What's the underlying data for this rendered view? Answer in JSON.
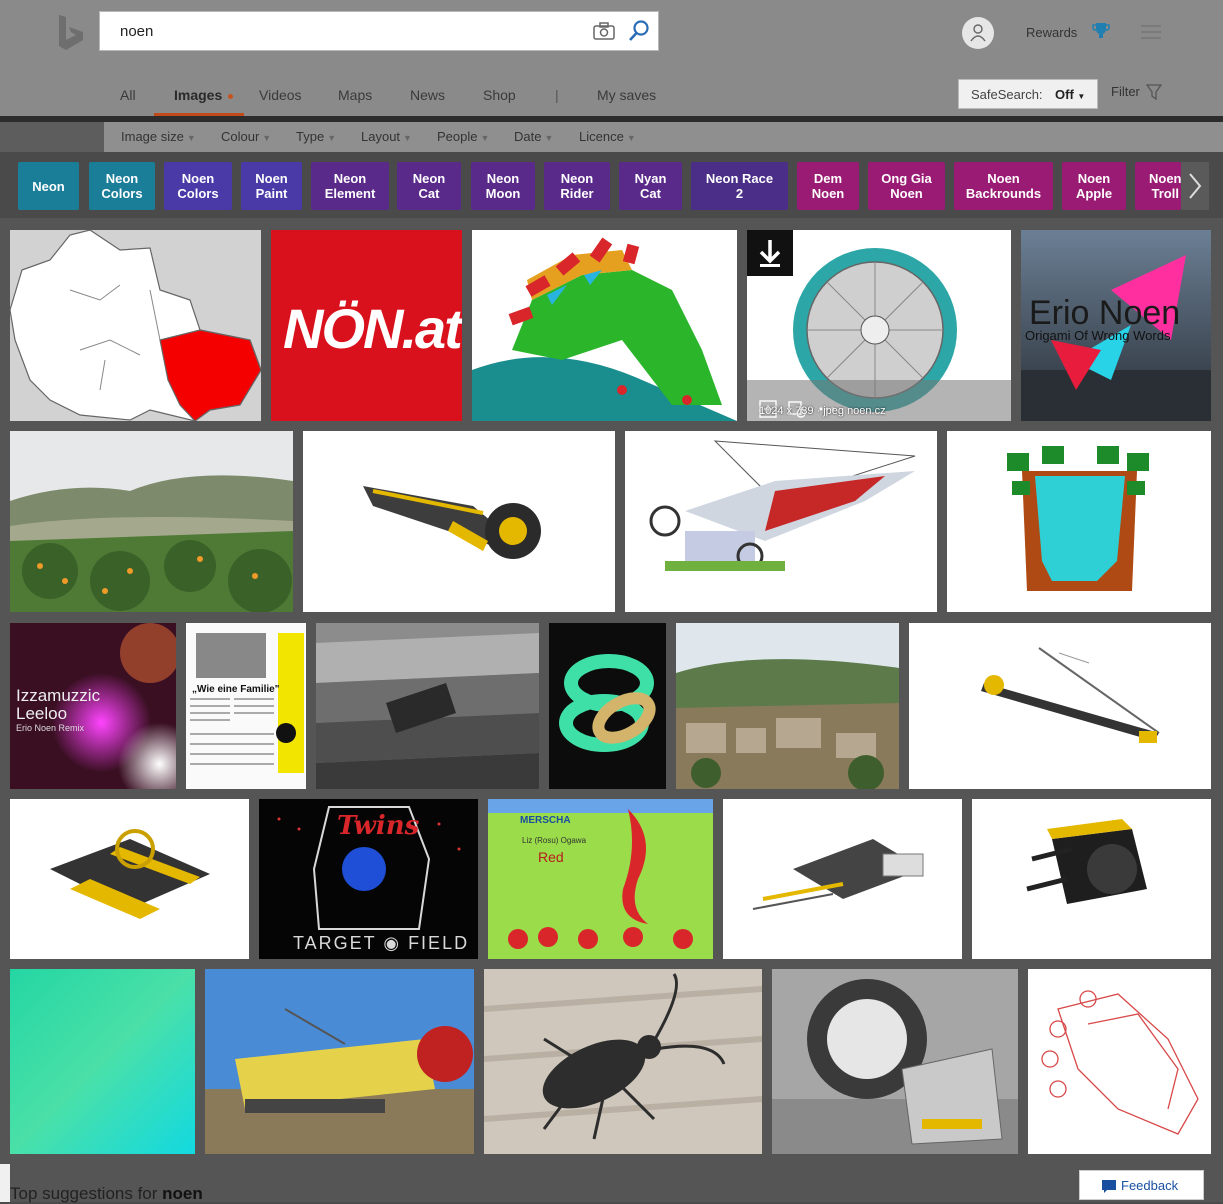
{
  "search": {
    "query": "noen"
  },
  "header": {
    "rewards_label": "Rewards",
    "tabs": [
      {
        "label": "All"
      },
      {
        "label": "Images"
      },
      {
        "label": "Videos"
      },
      {
        "label": "Maps"
      },
      {
        "label": "News"
      },
      {
        "label": "Shop"
      },
      {
        "label": "My saves"
      }
    ],
    "separator": "|",
    "safesearch_label": "SafeSearch:",
    "safesearch_value": "Off",
    "filter_label": "Filter"
  },
  "filters": [
    {
      "label": "Image size"
    },
    {
      "label": "Colour"
    },
    {
      "label": "Type"
    },
    {
      "label": "Layout"
    },
    {
      "label": "People"
    },
    {
      "label": "Date"
    },
    {
      "label": "Licence"
    }
  ],
  "related": [
    {
      "label": "Neon",
      "color": "#1b7e98"
    },
    {
      "label": "Neon\nColors",
      "color": "#1b7e98"
    },
    {
      "label": "Noen\nColors",
      "color": "#4a3aa8"
    },
    {
      "label": "Noen\nPaint",
      "color": "#4a3aa8"
    },
    {
      "label": "Neon\nElement",
      "color": "#5a2a8a"
    },
    {
      "label": "Neon\nCat",
      "color": "#5a2a8a"
    },
    {
      "label": "Neon\nMoon",
      "color": "#5a2a8a"
    },
    {
      "label": "Neon\nRider",
      "color": "#5a2a8a"
    },
    {
      "label": "Nyan\nCat",
      "color": "#5a2a8a"
    },
    {
      "label": "Neon Race\n2",
      "color": "#4a2e88"
    },
    {
      "label": "Dem\nNoen",
      "color": "#9a1b73"
    },
    {
      "label": "Ong Gia\nNoen",
      "color": "#9a1b73"
    },
    {
      "label": "Noen\nBackrounds",
      "color": "#9a1b73"
    },
    {
      "label": "Noen\nApple",
      "color": "#9a1b73"
    },
    {
      "label": "Noen\nTroll",
      "color": "#9a1b73"
    }
  ],
  "tiles": {
    "non_at_text": "NÖN.at",
    "erio_title": "Erio Noen",
    "erio_subtitle": "Origami Of Wrong Words",
    "hover_meta": "1024 x 739 · jpeg  noen.cz",
    "leeloo_line1": "Izzamuzzic",
    "leeloo_line2": "Leeloo",
    "leeloo_line3": "Erio Noen Remix",
    "news_heading": "„Wie eine Familie\"",
    "twins_text": "Twins",
    "target_field_text": "TARGET",
    "field_text": "FIELD",
    "mermaid_brand": "MERSCHA",
    "mermaid_author": "Liz (Rosu) Ogawa",
    "mermaid_title": "Red"
  },
  "bottom": {
    "suggestions_prefix": "Top suggestions for",
    "suggestions_query": "noen",
    "feedback_label": "Feedback"
  },
  "colors": {
    "accent": "#c04a1a",
    "feedback_text": "#1a4fa0"
  }
}
